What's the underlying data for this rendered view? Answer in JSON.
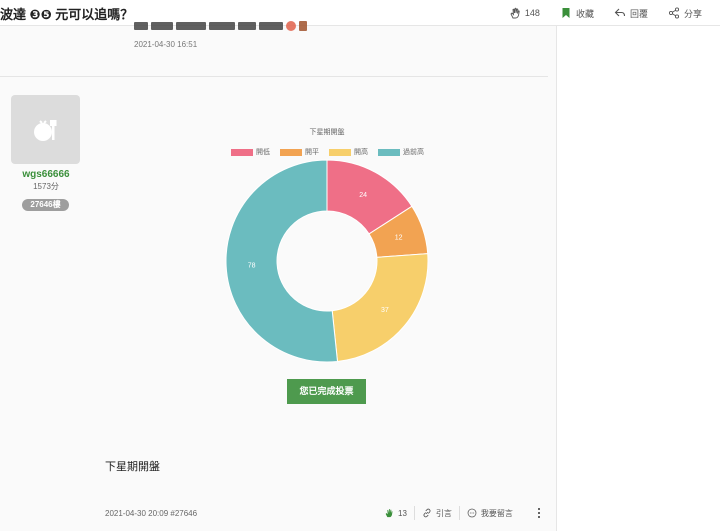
{
  "topbar": {
    "title": "波達 ❸❺ 元可以追嗎？",
    "actions": [
      {
        "icon": "hand-clap-icon",
        "label": "148"
      },
      {
        "icon": "bookmark-icon",
        "label": "收藏"
      },
      {
        "icon": "reply-icon",
        "label": "回覆"
      },
      {
        "icon": "share-icon",
        "label": "分享"
      }
    ]
  },
  "prev_post": {
    "date": "2021-04-30 16:51"
  },
  "author": {
    "username": "wgs66666",
    "score": "1573分",
    "floor": "27646樓"
  },
  "chart_data": {
    "type": "pie",
    "donut": true,
    "title": "下星期開盤",
    "categories": [
      "開低",
      "開平",
      "開高",
      "過前高"
    ],
    "values": [
      24,
      12,
      37,
      78
    ],
    "colors": [
      "#ef6f87",
      "#f2a352",
      "#f7cf6b",
      "#6bbcbf"
    ],
    "legend_position": "top"
  },
  "vote_button": "您已完成投票",
  "post_body": "下星期開盤",
  "post_meta": "2021-04-30 20:09 #27646",
  "post_actions": {
    "likes": "13",
    "quote": "引言",
    "comment": "我要留言"
  }
}
